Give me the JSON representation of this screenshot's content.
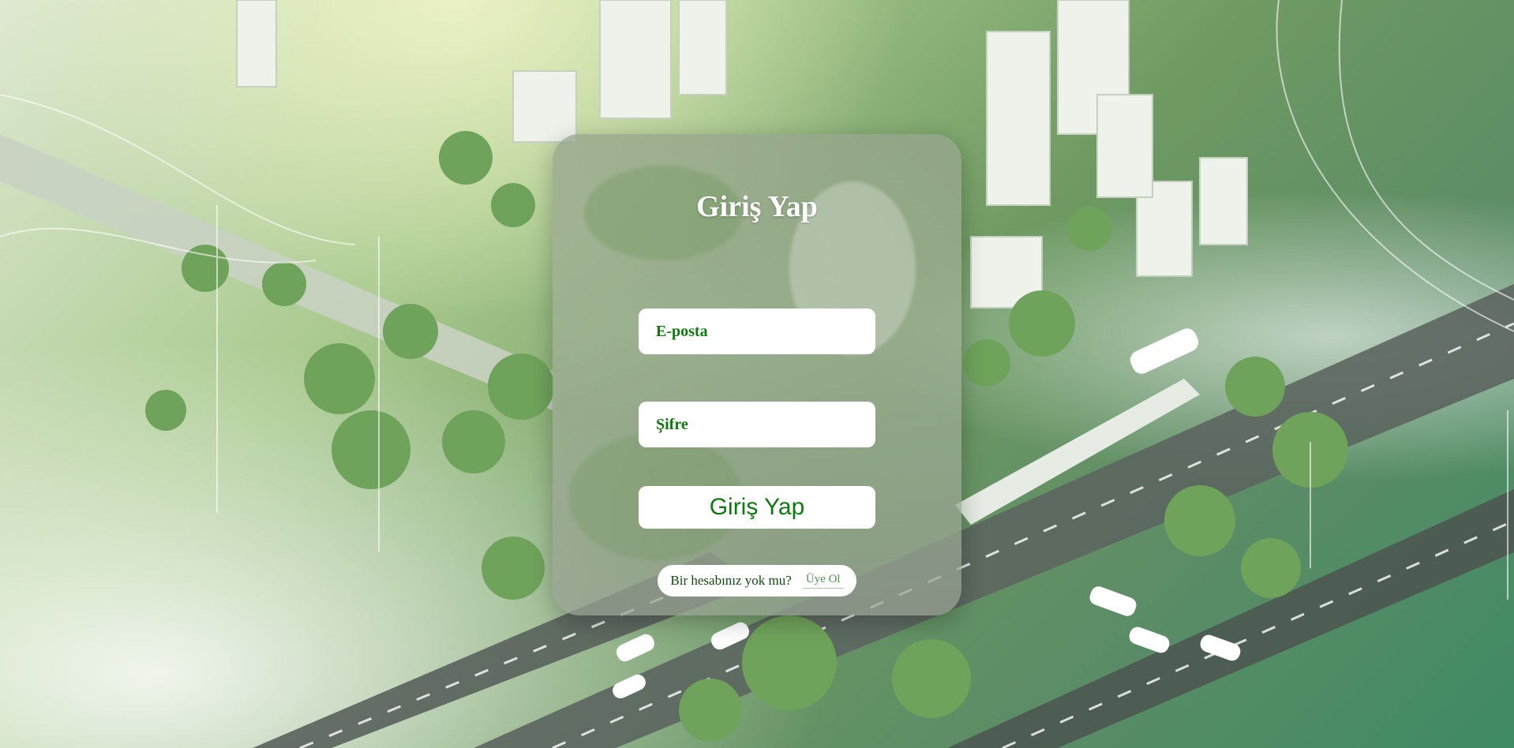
{
  "login": {
    "title": "Giriş Yap",
    "email_placeholder": "E-posta",
    "password_placeholder": "Şifre",
    "submit_label": "Giriş Yap",
    "signup_prompt": "Bir hesabınız yok mu?",
    "signup_link": "Üye Ol"
  },
  "colors": {
    "accent_green": "#0d7a0d",
    "card_bg": "rgba(150,165,140,0.75)",
    "field_bg": "#ffffff",
    "title_color": "#ffffff"
  }
}
